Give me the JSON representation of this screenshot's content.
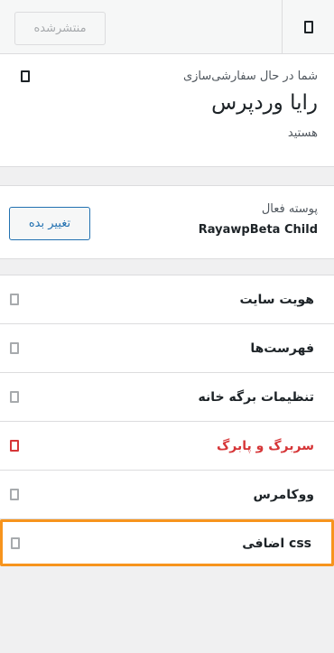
{
  "header": {
    "close_icon": "close-icon",
    "publish_label": "منتشرشده"
  },
  "info": {
    "pre": "شما در حال سفارشی‌سازی",
    "title": "رایا وردپرس",
    "post": "هستید",
    "help_icon": "help-icon"
  },
  "theme": {
    "label": "پوسته فعال",
    "name": "RayawpBeta Child",
    "change_label": "تغییر بده"
  },
  "menu": {
    "items": [
      {
        "label": "هویت سایت"
      },
      {
        "label": "فهرست‌ها"
      },
      {
        "label": "تنظیمات برگه خانه"
      },
      {
        "label": "سربرگ و پابرگ"
      },
      {
        "label": "ووکامرس"
      },
      {
        "label": "css اضافی"
      }
    ]
  },
  "colors": {
    "accent": "#d63638",
    "link": "#2271b1",
    "highlight_border": "#f7941d"
  }
}
